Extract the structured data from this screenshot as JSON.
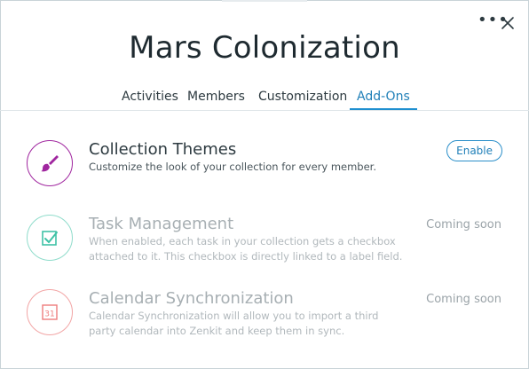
{
  "window": {
    "more_icon": "more-horizontal-icon",
    "close_icon": "close-icon"
  },
  "collection": {
    "title": "Mars Colonization"
  },
  "tabs": [
    {
      "label": "Activities",
      "active": false
    },
    {
      "label": "Members",
      "active": false
    },
    {
      "label": "Customization",
      "active": false
    },
    {
      "label": "Add-Ons",
      "active": true
    }
  ],
  "addons": [
    {
      "name": "Collection Themes",
      "description": "Customize the look of your collection for every member.",
      "action": "Enable",
      "icon": "paintbrush-icon",
      "color": "#a0269f"
    },
    {
      "name": "Task Management",
      "description": "When enabled, each task in your collection gets a checkbox attached to it. This checkbox is directly linked to a label field.",
      "status": "Coming soon",
      "icon": "checkbox-icon",
      "color": "#3fc2a6"
    },
    {
      "name": "Calendar Synchronization",
      "description": "Calendar Synchronization will allow you to import a third party calendar into Zenkit and keep them in sync.",
      "status": "Coming soon",
      "icon": "calendar-icon",
      "calendar_day": "31",
      "color": "#ee7d7d"
    }
  ],
  "colors": {
    "accent": "#1f7fb8",
    "text": "#2d3a40",
    "muted": "#a7afb3"
  }
}
